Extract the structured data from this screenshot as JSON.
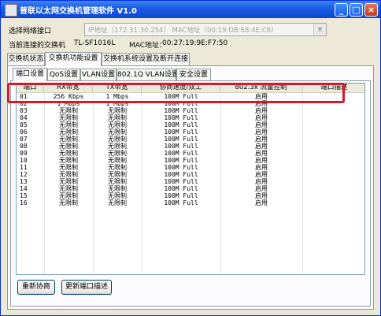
{
  "app": {
    "title": "普联以太网交换机管理软件 V1.0",
    "controls": {
      "minimize": "_",
      "maximize": "□",
      "close": "×"
    }
  },
  "top": {
    "select_interface_label": "选择网络接口",
    "interface_value": "IP地址（172.31.30.254）   MAC地址（00:19:DB:68:4E:C6）",
    "current_switch_label": "当前连接的交换机",
    "switch_model": "TL-SF1016L",
    "mac_label": "MAC地址：",
    "switch_mac": "00:27:19:9E:F7:50"
  },
  "main_tabs": [
    "交换机状态",
    "交换机功能设置",
    "交换机系统设置及断开连接"
  ],
  "main_tab_active": 1,
  "sub_tabs": [
    "端口设置",
    "QoS设置",
    "VLAN设置",
    "802.1Q VLAN设置",
    "安全设置"
  ],
  "sub_tab_active": 0,
  "table": {
    "columns": [
      "端口",
      "RX带宽",
      "TX带宽",
      "协商速度/双工",
      "802.3x 流量控制",
      "端口描述"
    ],
    "rows": [
      [
        "01",
        "256 Kbps",
        "1 Mbps",
        "100M Full",
        "启用",
        ""
      ],
      [
        "02",
        "1 Mbps",
        "1 Mbps",
        "100M Full",
        "启用",
        ""
      ],
      [
        "03",
        "无限制",
        "无限制",
        "100M Full",
        "启用",
        ""
      ],
      [
        "04",
        "无限制",
        "无限制",
        "100M Full",
        "启用",
        ""
      ],
      [
        "05",
        "无限制",
        "无限制",
        "100M Full",
        "启用",
        ""
      ],
      [
        "06",
        "无限制",
        "无限制",
        "100M Full",
        "启用",
        ""
      ],
      [
        "07",
        "无限制",
        "无限制",
        "100M Full",
        "启用",
        ""
      ],
      [
        "08",
        "无限制",
        "无限制",
        "100M Full",
        "启用",
        ""
      ],
      [
        "09",
        "无限制",
        "无限制",
        "100M Full",
        "启用",
        ""
      ],
      [
        "10",
        "无限制",
        "无限制",
        "100M Full",
        "启用",
        ""
      ],
      [
        "11",
        "无限制",
        "无限制",
        "100M Full",
        "启用",
        ""
      ],
      [
        "12",
        "无限制",
        "无限制",
        "100M Full",
        "启用",
        ""
      ],
      [
        "13",
        "无限制",
        "无限制",
        "100M Full",
        "启用",
        ""
      ],
      [
        "14",
        "无限制",
        "无限制",
        "100M Full",
        "启用",
        ""
      ],
      [
        "15",
        "无限制",
        "无限制",
        "100M Full",
        "启用",
        ""
      ],
      [
        "16",
        "无限制",
        "无限制",
        "100M Full",
        "启用",
        ""
      ]
    ]
  },
  "buttons": {
    "renegotiate": "重新协商",
    "update_desc": "更新端口描述"
  },
  "colors": {
    "highlight": "#d21a2b",
    "titlebar": "#0a46d3"
  }
}
